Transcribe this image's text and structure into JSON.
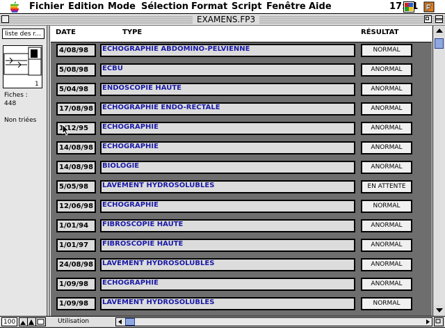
{
  "menubar": {
    "items": [
      "Fichier",
      "Edition",
      "Mode",
      "Sélection",
      "Format",
      "Script",
      "Fenêtre",
      "Aide"
    ],
    "clock": "17:11"
  },
  "window": {
    "title": "EXAMENS.FP3"
  },
  "status_panel": {
    "layout_popup": "liste des r...",
    "book_page": "1",
    "records_label": "Fiches :",
    "records_count": "448",
    "sort_status": "Non triées"
  },
  "columns": {
    "date": "DATE",
    "type": "TYPE",
    "result": "RÉSULTAT"
  },
  "records": [
    {
      "date": "4/08/98",
      "type": "ECHOGRAPHIE ABDOMINO-PELVIENNE",
      "result": "NORMAL"
    },
    {
      "date": "5/08/98",
      "type": "ECBU",
      "result": "ANORMAL"
    },
    {
      "date": "5/04/98",
      "type": "ENDOSCOPIE HAUTE",
      "result": "ANORMAL"
    },
    {
      "date": "17/08/98",
      "type": "ECHOGRAPHIE ENDO-RECTALE",
      "result": "ANORMAL"
    },
    {
      "date": "1/12/95",
      "type": "ECHOGRAPHIE",
      "result": "ANORMAL"
    },
    {
      "date": "14/08/98",
      "type": "ECHOGRAPHIE",
      "result": "ANORMAL"
    },
    {
      "date": "14/08/98",
      "type": "BIOLOGIE",
      "result": "ANORMAL"
    },
    {
      "date": "5/05/98",
      "type": "LAVEMENT HYDROSOLUBLES",
      "result": "EN ATTENTE"
    },
    {
      "date": "12/06/98",
      "type": "ECHOGRAPHIE",
      "result": "NORMAL"
    },
    {
      "date": "1/01/94",
      "type": "FIBROSCOPIE HAUTE",
      "result": "ANORMAL"
    },
    {
      "date": "1/01/97",
      "type": "FIBROSCOPIE HAUTE",
      "result": "ANORMAL"
    },
    {
      "date": "24/08/98",
      "type": "LAVEMENT HYDROSOLUBLES",
      "result": "ANORMAL"
    },
    {
      "date": "1/09/98",
      "type": "ECHOGRAPHIE",
      "result": "ANORMAL"
    },
    {
      "date": "1/09/98",
      "type": "LAVEMENT HYDROSOLUBLES",
      "result": "NORMAL"
    }
  ],
  "bottom_bar": {
    "zoom": "100",
    "mode": "Utilisation"
  },
  "icons": {
    "apple": "apple-menu-icon",
    "app_menu": "filemaker-app-icon",
    "help": "help-icon",
    "close": "close-box-icon",
    "zoom": "zoom-box-icon",
    "collapse": "collapse-box-icon",
    "book": "record-book-icon"
  },
  "colors": {
    "body_background": "#6e6e6e",
    "type_text": "#1a1aa6",
    "scroll_thumb": "#8fa8e0"
  }
}
